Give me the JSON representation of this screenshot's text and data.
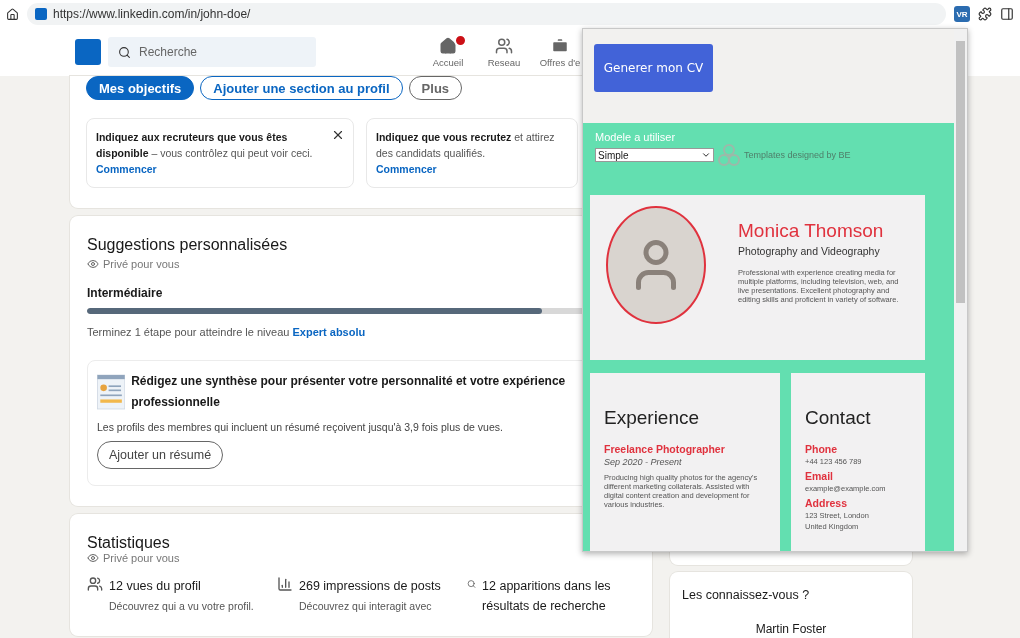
{
  "browser": {
    "url": "https://www.linkedin.com/in/john-doe/",
    "extension_label": "VR"
  },
  "nav": {
    "search_placeholder": "Recherche",
    "items": [
      {
        "label": "Accueil",
        "kind": "home",
        "notification": true
      },
      {
        "label": "Reseau",
        "kind": "network",
        "notification": false
      },
      {
        "label": "Offres d'e",
        "kind": "jobs",
        "notification": false
      }
    ]
  },
  "profile_actions": [
    {
      "label": "Mes objectifs",
      "kind": "primary"
    },
    {
      "label": "Ajouter une section au profil",
      "kind": "outline"
    },
    {
      "label": "Plus",
      "kind": "neutral"
    }
  ],
  "prompts": [
    {
      "text": "**Indiquez aux recruteurs que vous êtes disponible** – vous contrôlez qui peut voir ceci.",
      "link": "Commencer",
      "closable": true
    },
    {
      "text": "**Indiquez que vous recrutez** et attirez des candidats qualifiés.",
      "link": "Commencer",
      "closable": false
    }
  ],
  "suggestions": {
    "title": "Suggestions personnalisées",
    "privacy": "Privé pour vous",
    "level_label": "Intermédiaire",
    "level": 0.83,
    "hint": "Terminez 1 étape pour atteindre le niveau",
    "hint_link": "Expert absolu",
    "card": {
      "title": "Rédigez une synthèse pour présenter votre personnalité et votre expérience professionnelle",
      "body": "Les profils des membres qui incluent un résumé reçoivent jusqu'à 3,9 fois plus de vues.",
      "button": "Ajouter un résumé"
    }
  },
  "stats": {
    "title": "Statistiques",
    "privacy": "Privé pour vous",
    "items": [
      {
        "kind": "views",
        "title": "12 vues du profil",
        "desc": "Découvrez qui a vu votre profil."
      },
      {
        "kind": "impressions",
        "title": "269 impressions de posts",
        "desc": "Découvrez qui interagit avec"
      },
      {
        "kind": "search",
        "title": "12 apparitions dans les résultats de recherche"
      }
    ]
  },
  "side": {
    "people_title": "Les connaissez-vous ?",
    "people": [
      "Martin Foster"
    ]
  },
  "popup": {
    "button": "Generer mon CV",
    "template_label": "Modele a utiliser",
    "template_value": "Simple",
    "credit": "Templates designed by BE",
    "cv": {
      "name": "Monica Thomson",
      "headline": "Photography and Videography",
      "summary": "Professional with experience creating media for multiple platforms, including television, web, and live presentations. Excellent photography and editing skills and proficient in variety of software.",
      "experience_title": "Experience",
      "jobs": [
        {
          "title": "Freelance Photographer",
          "dates": "Sep 2020 - Present",
          "desc": "Producing high quality photos for the agency's different marketing collaterals. Assisted with digital content creation and development for various industries."
        }
      ],
      "contact_title": "Contact",
      "contact": [
        {
          "label": "Phone",
          "lines": [
            "+44 123 456 789"
          ]
        },
        {
          "label": "Email",
          "lines": [
            "example@example.com"
          ]
        },
        {
          "label": "Address",
          "lines": [
            "123 Street, London",
            "United Kingdom"
          ]
        }
      ]
    }
  }
}
